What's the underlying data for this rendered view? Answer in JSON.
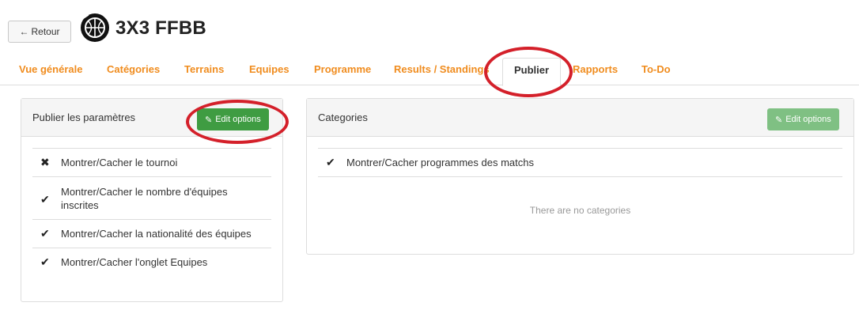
{
  "header": {
    "back_label": "Retour",
    "title": "3X3 FFBB"
  },
  "tabs": [
    {
      "label": "Vue générale",
      "active": false
    },
    {
      "label": "Catégories",
      "active": false
    },
    {
      "label": "Terrains",
      "active": false
    },
    {
      "label": "Equipes",
      "active": false
    },
    {
      "label": "Programme",
      "active": false
    },
    {
      "label": "Results / Standings",
      "active": false
    },
    {
      "label": "Publier",
      "active": true
    },
    {
      "label": "Rapports",
      "active": false
    },
    {
      "label": "To-Do",
      "active": false
    }
  ],
  "publish_panel": {
    "title": "Publier les paramètres",
    "edit_label": "Edit options",
    "items": [
      {
        "label": "Montrer/Cacher le tournoi",
        "state": "cross-icon"
      },
      {
        "label": "Montrer/Cacher le nombre d'équipes inscrites",
        "state": "check-icon"
      },
      {
        "label": "Montrer/Cacher la nationalité des équipes",
        "state": "check-icon"
      },
      {
        "label": "Montrer/Cacher l'onglet Equipes",
        "state": "check-icon"
      }
    ]
  },
  "categories_panel": {
    "title": "Categories",
    "edit_label": "Edit options",
    "items": [
      {
        "label": "Montrer/Cacher programmes des matchs",
        "state": "check-icon"
      }
    ],
    "empty_message": "There are no categories"
  },
  "colors": {
    "tab_text": "#f08c1e",
    "edit_button": "#3f9c42",
    "edit_button_disabled": "#7fc083",
    "annotation_ring": "#d4202a"
  }
}
